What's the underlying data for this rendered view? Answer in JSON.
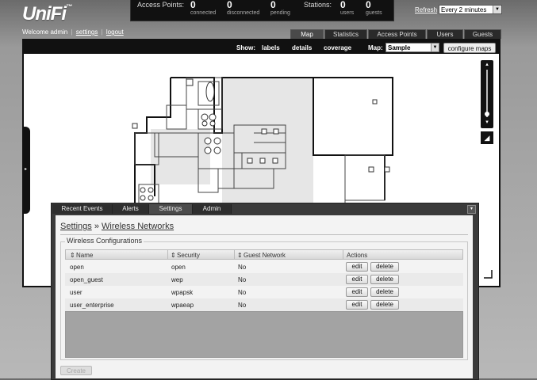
{
  "app": {
    "logo_text": "UniFi",
    "welcome_prefix": "Welcome",
    "user": "admin",
    "settings_link": "settings",
    "logout_link": "logout"
  },
  "stats": {
    "access_points_label": "Access Points:",
    "stations_label": "Stations:",
    "connected": {
      "value": "0",
      "label": "connected"
    },
    "disconnected": {
      "value": "0",
      "label": "disconnected"
    },
    "pending": {
      "value": "0",
      "label": "pending"
    },
    "users": {
      "value": "0",
      "label": "users"
    },
    "guests": {
      "value": "0",
      "label": "guests"
    }
  },
  "refresh": {
    "link": "Refresh",
    "interval": "Every 2 minutes"
  },
  "main_tabs": [
    {
      "label": "Map",
      "active": true
    },
    {
      "label": "Statistics",
      "active": false
    },
    {
      "label": "Access Points",
      "active": false
    },
    {
      "label": "Users",
      "active": false
    },
    {
      "label": "Guests",
      "active": false
    }
  ],
  "map_toolbar": {
    "show_label": "Show:",
    "labels": "labels",
    "details": "details",
    "coverage": "coverage",
    "map_label": "Map:",
    "map_value": "Sample",
    "configure_button": "configure maps"
  },
  "panel_tabs": [
    {
      "label": "Recent Events",
      "active": false
    },
    {
      "label": "Alerts",
      "active": false
    },
    {
      "label": "Settings",
      "active": true
    },
    {
      "label": "Admin",
      "active": false
    }
  ],
  "breadcrumb": {
    "root": "Settings",
    "separator": "»",
    "current": "Wireless Networks"
  },
  "wireless": {
    "legend": "Wireless Configurations",
    "columns": [
      "Name",
      "Security",
      "Guest Network",
      "Actions"
    ],
    "rows": [
      {
        "name": "open",
        "security": "open",
        "guest": "No"
      },
      {
        "name": "open_guest",
        "security": "wep",
        "guest": "No"
      },
      {
        "name": "user",
        "security": "wpapsk",
        "guest": "No"
      },
      {
        "name": "user_enterprise",
        "security": "wpaeap",
        "guest": "No"
      }
    ],
    "edit_label": "edit",
    "delete_label": "delete",
    "create_button": "Create"
  },
  "icons": {
    "dropdown": "chevron-down-icon",
    "collapse": "collapse-icon",
    "ruler": "ruler-icon",
    "zoom_in": "zoom-in-icon",
    "zoom_out": "zoom-out-icon"
  }
}
